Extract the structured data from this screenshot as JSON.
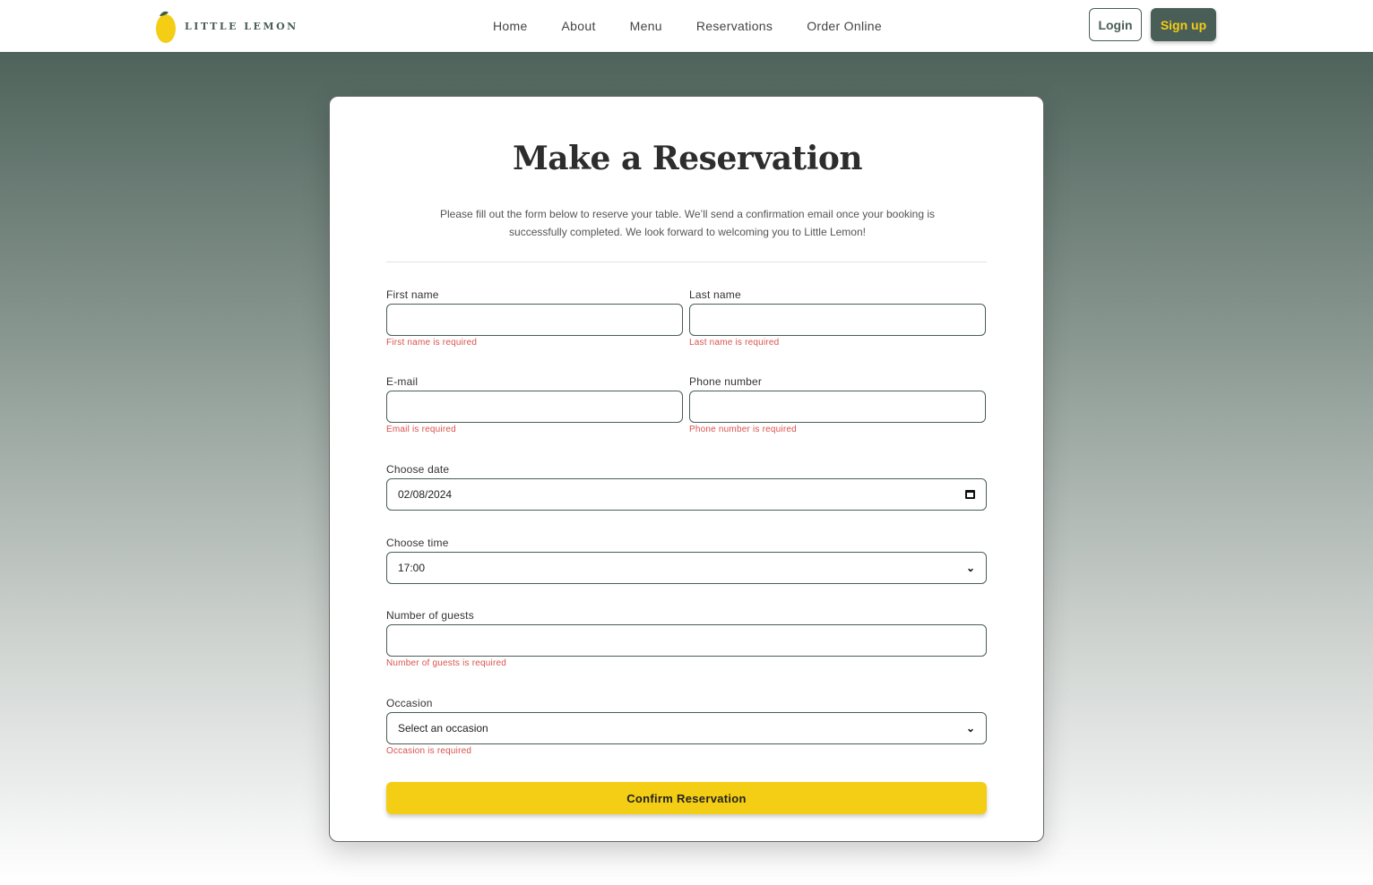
{
  "brand": {
    "name": "LITTLE LEMON",
    "colors": {
      "primary": "#495e57",
      "accent": "#f4ce14",
      "error": "#d9534f"
    }
  },
  "nav": {
    "items": [
      "Home",
      "About",
      "Menu",
      "Reservations",
      "Order Online"
    ],
    "login_label": "Login",
    "signup_label": "Sign up"
  },
  "form": {
    "title": "Make a Reservation",
    "intro": "Please fill out the form below to reserve your table. We’ll send a confirmation email once your booking is successfully completed. We look forward to welcoming you to Little Lemon!",
    "first_name": {
      "label": "First name",
      "value": "",
      "error": "First name is required"
    },
    "last_name": {
      "label": "Last name",
      "value": "",
      "error": "Last name is required"
    },
    "email": {
      "label": "E-mail",
      "value": "",
      "error": "Email is required"
    },
    "phone": {
      "label": "Phone number",
      "value": "",
      "error": "Phone number is required"
    },
    "date": {
      "label": "Choose date",
      "value": "02/08/2024"
    },
    "time": {
      "label": "Choose time",
      "value": "17:00"
    },
    "guests": {
      "label": "Number of guests",
      "value": "",
      "error": "Number of guests is required"
    },
    "occasion": {
      "label": "Occasion",
      "value": "Select an occasion",
      "error": "Occasion is required"
    },
    "submit_label": "Confirm Reservation"
  }
}
